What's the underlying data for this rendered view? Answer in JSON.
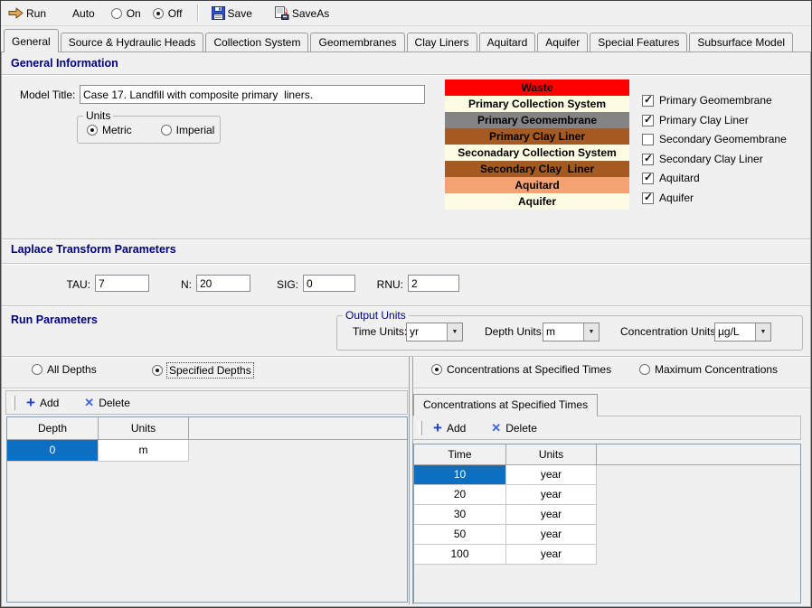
{
  "toolbar": {
    "run_label": "Run",
    "auto_label": "Auto",
    "on_label": "On",
    "off_label": "Off",
    "on_selected": false,
    "off_selected": true,
    "save_label": "Save",
    "saveas_label": "SaveAs"
  },
  "tabs": [
    {
      "label": "General",
      "active": true
    },
    {
      "label": "Source & Hydraulic Heads",
      "active": false
    },
    {
      "label": "Collection System",
      "active": false
    },
    {
      "label": "Geomembranes",
      "active": false
    },
    {
      "label": "Clay Liners",
      "active": false
    },
    {
      "label": "Aquitard",
      "active": false
    },
    {
      "label": "Aquifer",
      "active": false
    },
    {
      "label": "Special Features",
      "active": false
    },
    {
      "label": "Subsurface Model",
      "active": false
    }
  ],
  "general_info": {
    "header": "General Information",
    "model_title_label": "Model Title:",
    "model_title_value": "Case 17. Landfill with composite primary  liners.",
    "units_group": {
      "label": "Units",
      "metric_label": "Metric",
      "imperial_label": "Imperial",
      "metric_selected": true,
      "imperial_selected": false
    },
    "layers": [
      {
        "label": "Waste",
        "bg": "#FF0000"
      },
      {
        "label": "Primary Collection System",
        "bg": "#FDFCE3"
      },
      {
        "label": "Primary Geomembrane",
        "bg": "#848484"
      },
      {
        "label": "Primary Clay Liner",
        "bg": "#A55A21"
      },
      {
        "label": "Seconadary Collection System",
        "bg": "#FDFCE3"
      },
      {
        "label": "Secondary Clay  Liner",
        "bg": "#A55A21"
      },
      {
        "label": "Aquitard",
        "bg": "#F5A273"
      },
      {
        "label": "Aquifer",
        "bg": "#FDFCE3"
      }
    ],
    "layer_checkboxes": [
      {
        "label": "Primary Geomembrane",
        "checked": true
      },
      {
        "label": "Primary Clay Liner",
        "checked": true
      },
      {
        "label": "Secondary Geomembrane",
        "checked": false
      },
      {
        "label": "Secondary Clay Liner",
        "checked": true
      },
      {
        "label": "Aquitard",
        "checked": true
      },
      {
        "label": "Aquifer",
        "checked": true
      }
    ]
  },
  "laplace": {
    "header": "Laplace Transform Parameters",
    "fields": [
      {
        "label": "TAU:",
        "value": "7"
      },
      {
        "label": "N:",
        "value": "20"
      },
      {
        "label": "SIG:",
        "value": "0"
      },
      {
        "label": "RNU:",
        "value": "2"
      }
    ]
  },
  "run_parameters": {
    "header": "Run Parameters",
    "output_units": {
      "label": "Output Units",
      "time_units_label": "Time Units:",
      "time_units_value": "yr",
      "depth_units_label": "Depth Units:",
      "depth_units_value": "m",
      "concentration_units_label": "Concentration Units:",
      "concentration_units_value": "µg/L"
    },
    "depth_mode": {
      "all_label": "All Depths",
      "specified_label": "Specified Depths",
      "all_selected": false,
      "specified_selected": true
    },
    "concentration_mode": {
      "specified_label": "Concentrations at Specified Times",
      "maximum_label": "Maximum Concentrations",
      "specified_selected": true,
      "maximum_selected": false
    }
  },
  "depth_panel": {
    "add_label": "Add",
    "delete_label": "Delete",
    "columns": [
      "Depth",
      "Units"
    ],
    "rows": [
      [
        "0",
        "m"
      ]
    ],
    "selected_rows": {
      "0": true
    }
  },
  "times_panel": {
    "tab_label": "Concentrations at Specified Times",
    "add_label": "Add",
    "delete_label": "Delete",
    "columns": [
      "Time",
      "Units"
    ],
    "rows": [
      [
        "10",
        "year"
      ],
      [
        "20",
        "year"
      ],
      [
        "30",
        "year"
      ],
      [
        "50",
        "year"
      ],
      [
        "100",
        "year"
      ]
    ],
    "selected_rows": {
      "0": true
    }
  },
  "colors": {
    "selection_blue": "#0D6FC2",
    "header_navy": "#00007B",
    "grid_border": "#7F9DB9"
  }
}
